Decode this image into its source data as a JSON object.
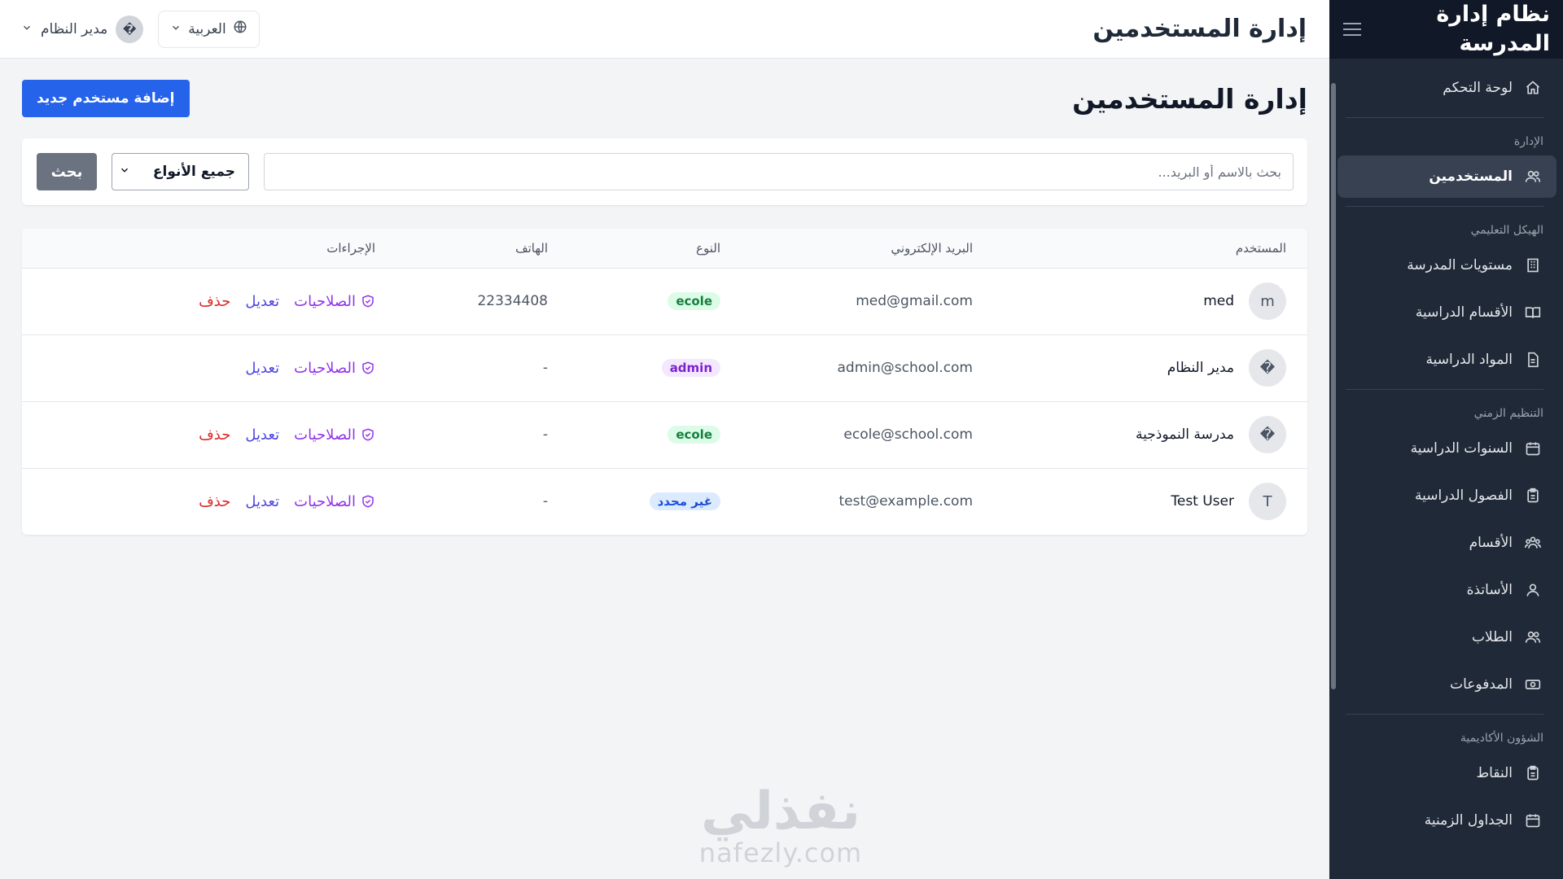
{
  "app": {
    "title": "نظام إدارة المدرسة"
  },
  "header": {
    "title": "إدارة المستخدمين",
    "language_label": "العربية",
    "user_name": "مدير النظام",
    "user_avatar": "�"
  },
  "sidebar": {
    "dashboard": "لوحة التحكم",
    "sections": [
      {
        "label": "الإدارة",
        "items": [
          "المستخدمين"
        ]
      },
      {
        "label": "الهيكل التعليمي",
        "items": [
          "مستويات المدرسة",
          "الأقسام الدراسية",
          "المواد الدراسية"
        ]
      },
      {
        "label": "التنظيم الزمني",
        "items": [
          "السنوات الدراسية",
          "الفصول الدراسية",
          "الأقسام",
          "الأساتذة",
          "الطلاب",
          "المدفوعات"
        ]
      },
      {
        "label": "الشؤون الأكاديمية",
        "items": [
          "النقاط",
          "الجداول الزمنية"
        ]
      }
    ],
    "active_item": "المستخدمين"
  },
  "page": {
    "title": "إدارة المستخدمين",
    "add_button": "إضافة مستخدم جديد"
  },
  "filters": {
    "search_placeholder": "بحث بالاسم أو البريد...",
    "search_value": "",
    "type_selected": "جميع الأنواع",
    "search_button": "بحث"
  },
  "table": {
    "columns": {
      "user": "المستخدم",
      "email": "البريد الإلكتروني",
      "type": "النوع",
      "phone": "الهاتف",
      "actions": "الإجراءات"
    },
    "action_labels": {
      "permissions": "الصلاحيات",
      "edit": "تعديل",
      "delete": "حذف"
    },
    "rows": [
      {
        "avatar": "m",
        "name": "med",
        "email": "med@gmail.com",
        "type": "ecole",
        "phone": "22334408",
        "deletable": true
      },
      {
        "avatar": "�",
        "name": "مدير النظام",
        "email": "admin@school.com",
        "type": "admin",
        "phone": "-",
        "deletable": false
      },
      {
        "avatar": "�",
        "name": "مدرسة النموذجية",
        "email": "ecole@school.com",
        "type": "ecole",
        "phone": "-",
        "deletable": true
      },
      {
        "avatar": "T",
        "name": "Test User",
        "email": "test@example.com",
        "type": "غير محدد",
        "phone": "-",
        "deletable": true
      }
    ]
  },
  "watermark": {
    "arabic": "نفذلي",
    "latin": "nafezly.com"
  },
  "colors": {
    "primary": "#2563eb",
    "sidebar_bg": "#1f2937",
    "sidebar_head_bg": "#111827",
    "badge_ecole_bg": "#dcfce7",
    "badge_ecole_fg": "#15803d",
    "badge_admin_bg": "#f3e8ff",
    "badge_admin_fg": "#7e22ce",
    "badge_undefined_bg": "#dbeafe",
    "badge_undefined_fg": "#1d4ed8",
    "permissions": "#9333ea",
    "edit": "#4f46e5",
    "delete": "#dc2626"
  },
  "icons": {
    "dashboard": "home-icon",
    "users": "users-icon",
    "levels": "building-icon",
    "departments": "book-icon",
    "subjects": "document-icon",
    "years": "calendar-icon",
    "terms": "clipboard-icon",
    "classes": "group-icon",
    "teachers": "user-icon",
    "students": "users-icon",
    "payments": "cash-icon",
    "grades": "clipboard-icon",
    "timetables": "calendar-icon"
  }
}
